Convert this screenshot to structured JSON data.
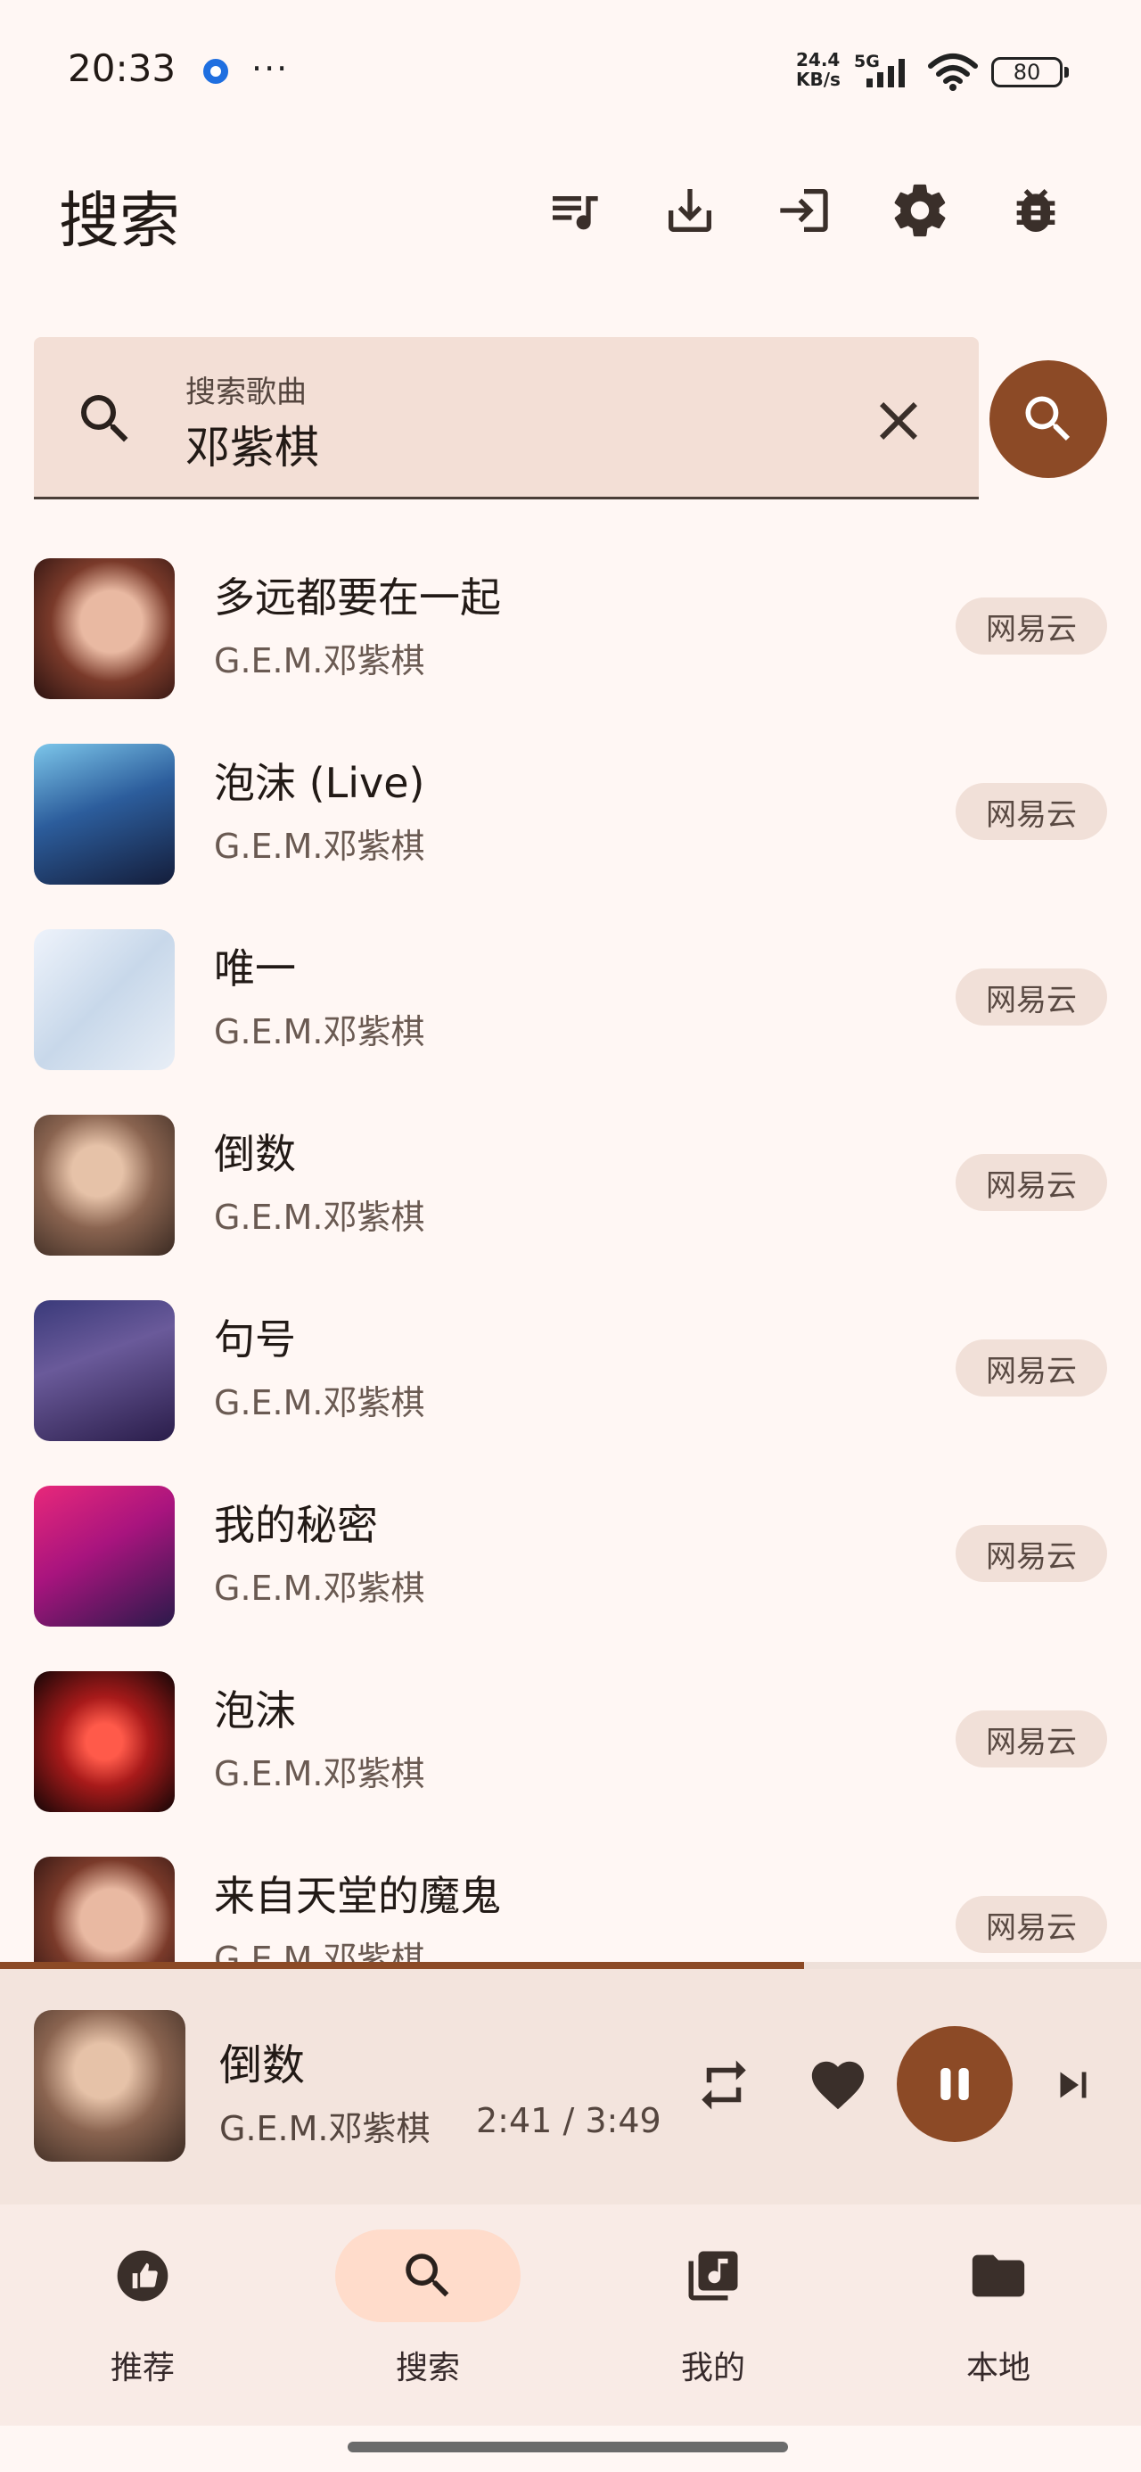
{
  "status_bar": {
    "time": "20:33",
    "net_speed_value": "24.4",
    "net_speed_unit": "KB/s",
    "network_type": "5G",
    "battery": "80",
    "more": "···"
  },
  "header": {
    "title": "搜索",
    "icons": [
      "playlist-icon",
      "download-icon",
      "login-icon",
      "settings-icon",
      "bug-icon"
    ]
  },
  "search": {
    "label": "搜索歌曲",
    "value": "邓紫棋"
  },
  "results": [
    {
      "title": "多远都要在一起",
      "artist": "G.E.M.邓紫棋",
      "source": "网易云"
    },
    {
      "title": "泡沫 (Live)",
      "artist": "G.E.M.邓紫棋",
      "source": "网易云"
    },
    {
      "title": "唯一",
      "artist": "G.E.M.邓紫棋",
      "source": "网易云"
    },
    {
      "title": "倒数",
      "artist": "G.E.M.邓紫棋",
      "source": "网易云"
    },
    {
      "title": "句号",
      "artist": "G.E.M.邓紫棋",
      "source": "网易云"
    },
    {
      "title": "我的秘密",
      "artist": "G.E.M.邓紫棋",
      "source": "网易云"
    },
    {
      "title": "泡沫",
      "artist": "G.E.M.邓紫棋",
      "source": "网易云"
    },
    {
      "title": "来自天堂的魔鬼",
      "artist": "G.E.M.邓紫棋",
      "source": "网易云"
    }
  ],
  "player": {
    "title": "倒数",
    "artist": "G.E.M.邓紫棋",
    "position": "2:41",
    "separator": "/",
    "duration": "3:49",
    "progress_fraction": 0.705
  },
  "nav": {
    "items": [
      {
        "label": "推荐",
        "icon": "thumb-up-icon"
      },
      {
        "label": "搜索",
        "icon": "search-icon",
        "active": true
      },
      {
        "label": "我的",
        "icon": "library-music-icon"
      },
      {
        "label": "本地",
        "icon": "folder-icon"
      }
    ]
  },
  "colors": {
    "accent": "#8c4a26",
    "background": "#fff7f4",
    "active_pill": "#ffdccb"
  }
}
